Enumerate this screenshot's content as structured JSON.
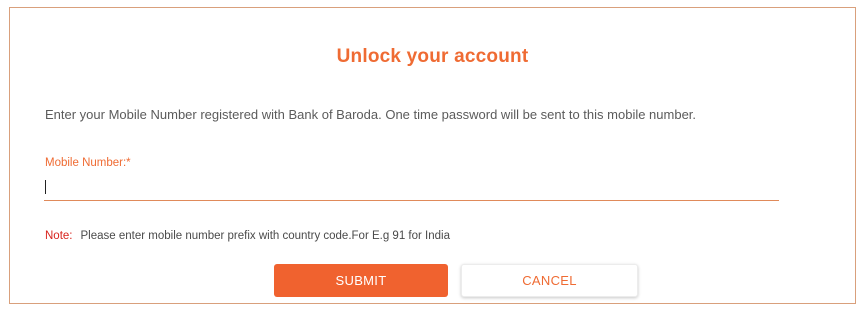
{
  "dialog": {
    "title": "Unlock your account",
    "instructions": "Enter your Mobile Number registered with Bank of Baroda. One time password will be sent to this mobile number.",
    "mobile_field": {
      "label": "Mobile Number:",
      "required_marker": "*",
      "value": "",
      "placeholder": ""
    },
    "note": {
      "label": "Note:",
      "text": "Please enter mobile number prefix with country code.For E.g 91 for India"
    },
    "buttons": {
      "submit_label": "SUBMIT",
      "cancel_label": "CANCEL"
    }
  },
  "colors": {
    "accent": "#ef6b33",
    "submit_bg": "#f0622f",
    "note_label": "#d8231c",
    "panel_border": "#d9a07c"
  }
}
